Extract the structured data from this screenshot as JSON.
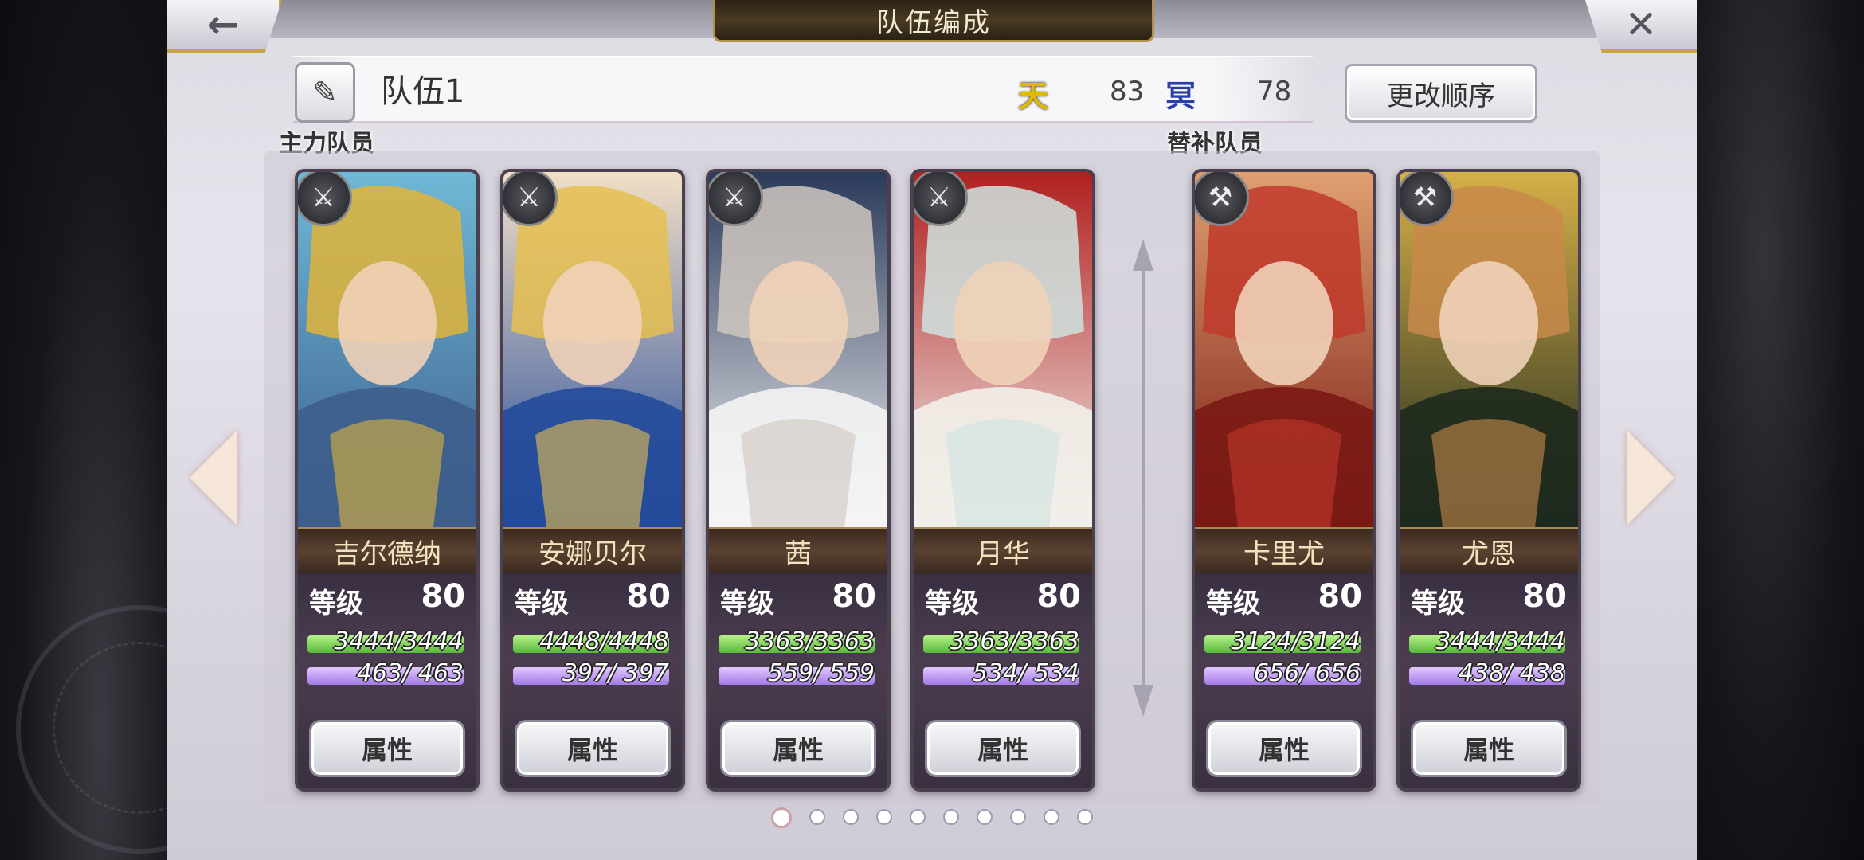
{
  "header": {
    "title": "队伍编成",
    "back_icon": "←",
    "close_icon": "✕"
  },
  "team": {
    "edit_icon": "✎",
    "name": "队伍1",
    "heaven_icon": "天",
    "heaven_value": "83",
    "underworld_icon": "冥",
    "underworld_value": "78",
    "order_button": "更改顺序"
  },
  "sections": {
    "main": "主力队员",
    "reserve": "替补队员"
  },
  "colors": {
    "heaven": "#e0b800",
    "underworld": "#2a3fa8"
  },
  "members": [
    {
      "name": "吉尔德纳",
      "level_label": "等级",
      "level": "80",
      "hp": "3444/3444",
      "mp": "463/ 463",
      "weapon": "sword-icon",
      "weapon_glyph": "⚔",
      "attr": "属性",
      "palette": [
        "#3d5e8c",
        "#e0b43a",
        "#6fb8d6"
      ]
    },
    {
      "name": "安娜贝尔",
      "level_label": "等级",
      "level": "80",
      "hp": "4448/4448",
      "mp": "397/ 397",
      "weapon": "sword-icon",
      "weapon_glyph": "⚔",
      "attr": "属性",
      "palette": [
        "#234a9a",
        "#e6c050",
        "#f2dfc6"
      ]
    },
    {
      "name": "茜",
      "level_label": "等级",
      "level": "80",
      "hp": "3363/3363",
      "mp": "559/ 559",
      "weapon": "katana-icon",
      "weapon_glyph": "⚔",
      "attr": "属性",
      "palette": [
        "#f4f4f4",
        "#cfc7bf",
        "#2a3a5a"
      ]
    },
    {
      "name": "月华",
      "level_label": "等级",
      "level": "80",
      "hp": "3363/3363",
      "mp": "534/ 534",
      "weapon": "katana-icon",
      "weapon_glyph": "⚔",
      "attr": "属性",
      "palette": [
        "#f2f0ea",
        "#cfe3df",
        "#b02020"
      ]
    },
    {
      "name": "卡里尤",
      "level_label": "等级",
      "level": "80",
      "hp": "3124/3124",
      "mp": "656/ 656",
      "weapon": "claw-icon",
      "weapon_glyph": "⚒",
      "attr": "属性",
      "palette": [
        "#7a1a14",
        "#c0392b",
        "#e0a070"
      ]
    },
    {
      "name": "尤恩",
      "level_label": "等级",
      "level": "80",
      "hp": "3444/3444",
      "mp": "438/ 438",
      "weapon": "hammer-icon",
      "weapon_glyph": "⚒",
      "attr": "属性",
      "palette": [
        "#1e2a1e",
        "#c88a4a",
        "#d6b048"
      ]
    }
  ],
  "pagination": {
    "total": 10,
    "active": 0
  }
}
